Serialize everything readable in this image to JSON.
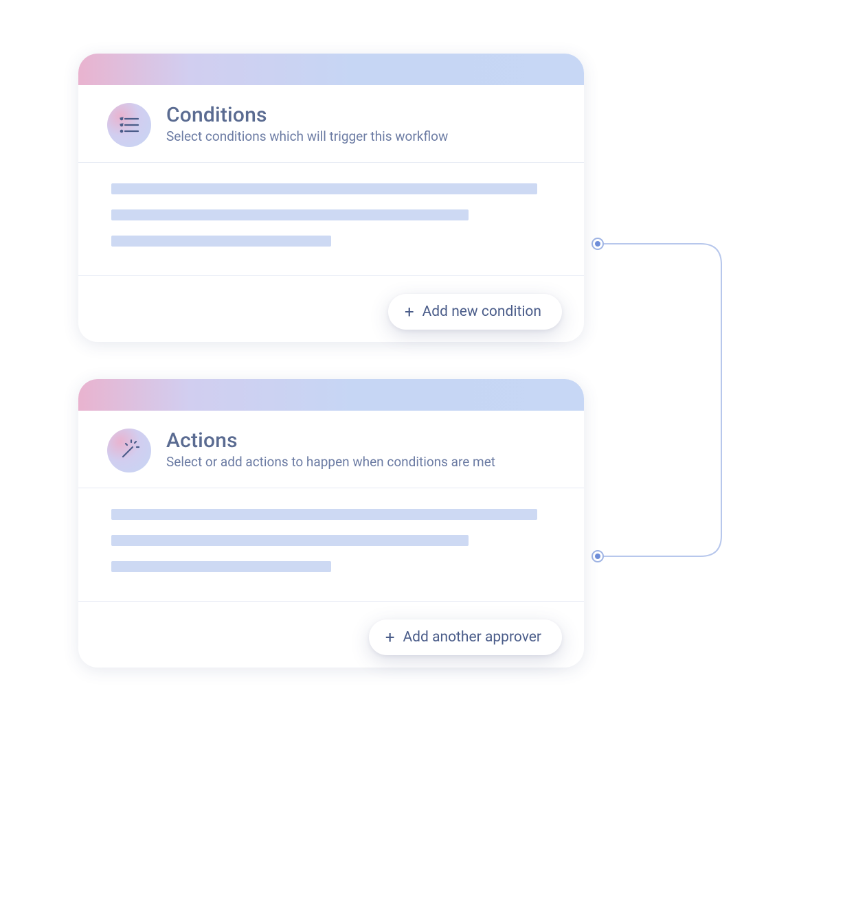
{
  "cards": {
    "conditions": {
      "title": "Conditions",
      "subtitle": "Select conditions which will trigger this workflow",
      "button_label": "Add new condition"
    },
    "actions": {
      "title": "Actions",
      "subtitle": "Select or add actions to happen when conditions are met",
      "button_label": "Add another approver"
    }
  },
  "colors": {
    "text_primary": "#5a6b91",
    "text_secondary": "#6b7ba3",
    "placeholder": "#cdd9f3",
    "accent": "#6f8ed9"
  }
}
